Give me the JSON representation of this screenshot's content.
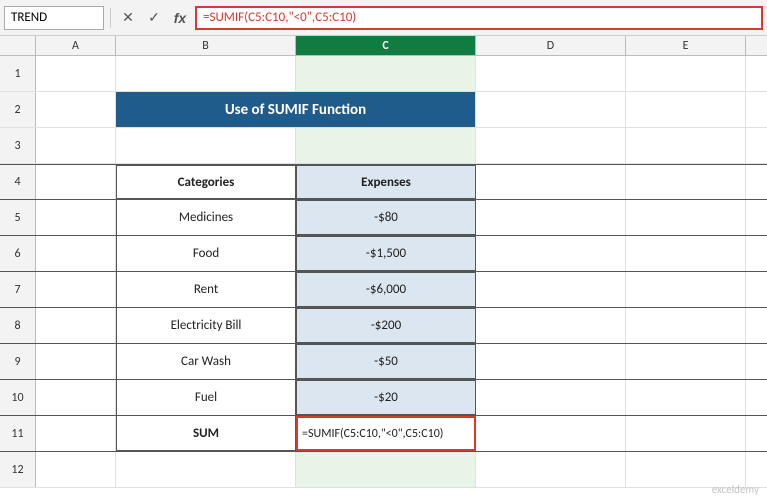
{
  "formula_bar": {
    "name_box": "TREND",
    "formula_text": "=SUMIF(C5:C10,\"<0\",C5:C10)",
    "cancel_label": "✕",
    "confirm_label": "✓",
    "fx_label": "fx"
  },
  "columns": {
    "headers": [
      "A",
      "B",
      "C",
      "D",
      "E"
    ]
  },
  "title": {
    "text": "Use of SUMIF Function"
  },
  "table": {
    "headers": [
      "Categories",
      "Expenses"
    ],
    "rows": [
      {
        "category": "Medicines",
        "expense": "-$80"
      },
      {
        "category": "Food",
        "expense": "-$1,500"
      },
      {
        "category": "Rent",
        "expense": "-$6,000"
      },
      {
        "category": "Electricity Bill",
        "expense": "-$200"
      },
      {
        "category": "Car Wash",
        "expense": "-$50"
      },
      {
        "category": "Fuel",
        "expense": "-$20"
      }
    ],
    "sum_label": "SUM",
    "sum_formula": "=SUMIF(C5:C10,\"<0\",C5:C10)"
  },
  "row_numbers": [
    "1",
    "2",
    "3",
    "4",
    "5",
    "6",
    "7",
    "8",
    "9",
    "10",
    "11",
    "12"
  ]
}
